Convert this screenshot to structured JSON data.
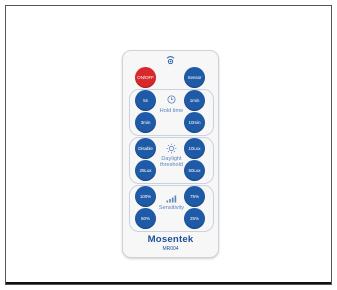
{
  "remote": {
    "top_buttons": {
      "power": "ON/OFF",
      "sensor": "Sensor"
    },
    "hold_time": {
      "label": "Hold time",
      "buttons": [
        "5s",
        "1min",
        "3min",
        "10min"
      ],
      "icon": "clock-icon"
    },
    "daylight": {
      "label_line1": "Daylight",
      "label_line2": "threshold",
      "buttons": [
        "Disable",
        "10Lux",
        "25Lux",
        "50Lux"
      ],
      "icon": "sun-icon"
    },
    "sensitivity": {
      "label": "Sensitivity",
      "buttons": [
        "100%",
        "75%",
        "50%",
        "25%"
      ],
      "icon": "signal-bars-icon"
    },
    "brand": "Mosentek",
    "model": "MR004"
  },
  "colors": {
    "button_blue": "#1e5aa6",
    "power_red": "#d8282c",
    "label_blue": "#5d83b8",
    "brand_blue": "#1e4f95"
  }
}
